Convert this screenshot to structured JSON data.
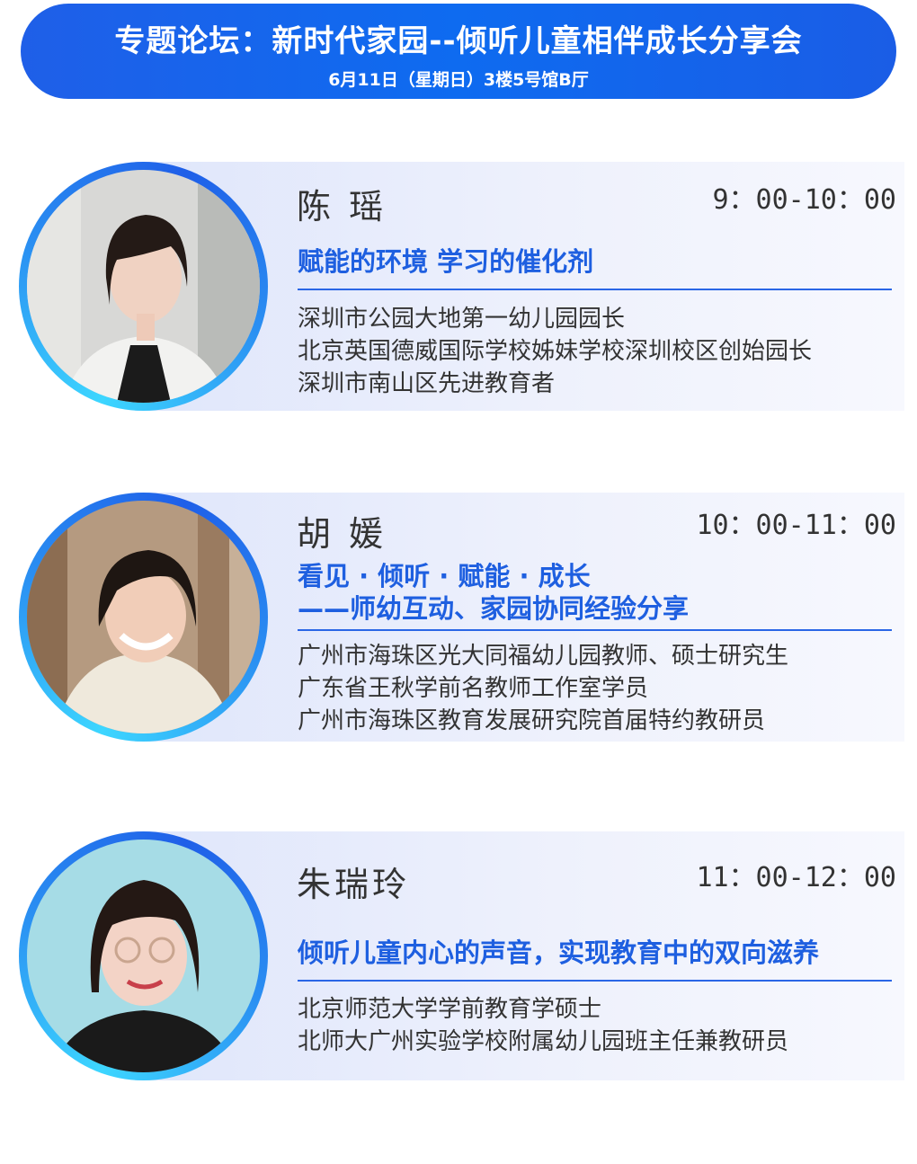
{
  "header": {
    "title": "专题论坛：新时代家园--倾听儿童相伴成长分享会",
    "subtitle": "6月11日（星期日）3楼5号馆B厅"
  },
  "speakers": [
    {
      "name": "陈 瑶",
      "time": "9：00-10：00",
      "topic_lines": [
        "赋能的环境  学习的催化剂"
      ],
      "bio": [
        "深圳市公园大地第一幼儿园园长",
        "北京英国德威国际学校姊妹学校深圳校区创始园长",
        "深圳市南山区先进教育者"
      ]
    },
    {
      "name": "胡 媛",
      "time": "10：00-11：00",
      "topic_lines": [
        "看见 · 倾听 · 赋能 · 成长",
        "——师幼互动、家园协同经验分享"
      ],
      "bio": [
        "广州市海珠区光大同福幼儿园教师、硕士研究生",
        "广东省王秋学前名教师工作室学员",
        "广州市海珠区教育发展研究院首届特约教研员"
      ]
    },
    {
      "name": "朱瑞玲",
      "time": "11：00-12：00",
      "topic_lines": [
        "倾听儿童内心的声音，实现教育中的双向滋养"
      ],
      "bio": [
        "北京师范大学学前教育学硕士",
        "北师大广州实验学校附属幼儿园班主任兼教研员"
      ]
    }
  ],
  "colors": {
    "banner": "#1f5fe8",
    "accent_text": "#1e5fe0",
    "ring_light": "#3dd6ff",
    "body_text": "#333333"
  }
}
